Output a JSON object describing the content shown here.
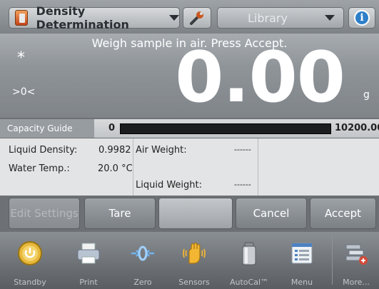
{
  "topbar": {
    "app_label": "Density Determination",
    "library_label": "Library",
    "info_glyph": "i",
    "icons": [
      "density-app-icon",
      "wrench-icon",
      "info-icon"
    ]
  },
  "display": {
    "instruction": "Weigh sample in air. Press Accept.",
    "stability_indicator": "*",
    "zero_indicator": ">0<",
    "reading": "0.00",
    "unit": "g"
  },
  "capacity": {
    "label": "Capacity Guide",
    "min": "0",
    "max": "10200.00",
    "fill_percent": 0
  },
  "info_panel": {
    "liquid_density_label": "Liquid Density:",
    "liquid_density_value": "0.9982",
    "water_temp_label": "Water Temp.:",
    "water_temp_value": "20.0 °C",
    "air_weight_label": "Air Weight:",
    "air_weight_value": "------",
    "liquid_weight_label": "Liquid Weight:",
    "liquid_weight_value": "------"
  },
  "actions": {
    "edit_settings": "Edit Settings",
    "tare": "Tare",
    "cancel": "Cancel",
    "accept": "Accept"
  },
  "bottom_nav": [
    {
      "label": "Standby",
      "icon": "standby-icon"
    },
    {
      "label": "Print",
      "icon": "printer-icon"
    },
    {
      "label": "Zero",
      "icon": "zero-icon"
    },
    {
      "label": "Sensors",
      "icon": "hand-sensor-icon"
    },
    {
      "label": "AutoCal™",
      "icon": "calibration-weight-icon"
    },
    {
      "label": "Menu",
      "icon": "menu-list-icon"
    },
    {
      "label": "More...",
      "icon": "more-icon"
    }
  ],
  "colors": {
    "capacity_fill": "#3ab54a",
    "info_blue": "#2e7fc8",
    "app_icon_orange": "#c4431a"
  }
}
